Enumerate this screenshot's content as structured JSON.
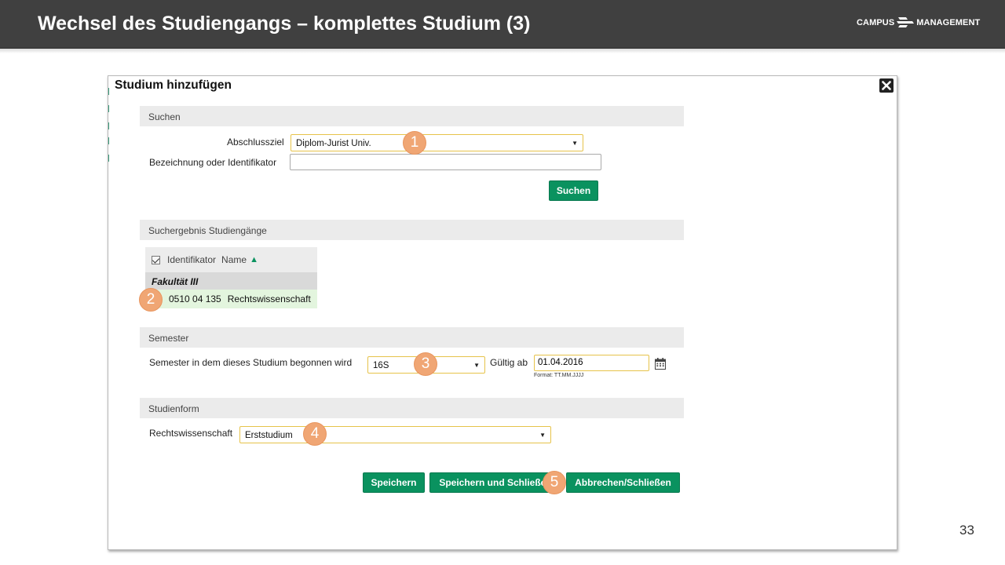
{
  "slide": {
    "title": "Wechsel des Studiengangs – komplettes Studium (3)",
    "logo_left": "CAMPUS",
    "logo_right": "MANAGEMENT",
    "page_number": "33"
  },
  "dialog": {
    "title": "Studium hinzufügen",
    "close_icon": "close-icon"
  },
  "search": {
    "section_title": "Suchen",
    "abschluss_label": "Abschlussziel",
    "abschluss_value": "Diplom-Jurist Univ.",
    "bezeichnung_label": "Bezeichnung oder Identifikator",
    "bezeichnung_value": "",
    "search_button": "Suchen"
  },
  "results": {
    "section_title": "Suchergebnis Studiengänge",
    "columns": [
      "Identifikator",
      "Name"
    ],
    "sort_indicator": "▲",
    "group": "Fakultät III",
    "rows": [
      {
        "identifikator": "0510 04 135",
        "name": "Rechtswissenschaft"
      }
    ]
  },
  "semester": {
    "section_title": "Semester",
    "label": "Semester in dem dieses Studium begonnen wird",
    "value": "16S",
    "gueltig_label": "Gültig ab",
    "gueltig_value": "01.04.2016",
    "format_hint": "Format: TT.MM.JJJJ"
  },
  "studienform": {
    "section_title": "Studienform",
    "label": "Rechtswissenschaft",
    "value": "Erststudium"
  },
  "actions": {
    "save": "Speichern",
    "save_close": "Speichern und Schließen",
    "cancel_close": "Abbrechen/Schließen"
  },
  "markers": [
    "1",
    "2",
    "3",
    "4",
    "5"
  ],
  "colors": {
    "header_bg": "#404040",
    "button_green": "#0a925f",
    "marker_orange": "#f0a674",
    "select_highlight": "#e6c34a",
    "row_selected": "#e3f5de"
  }
}
